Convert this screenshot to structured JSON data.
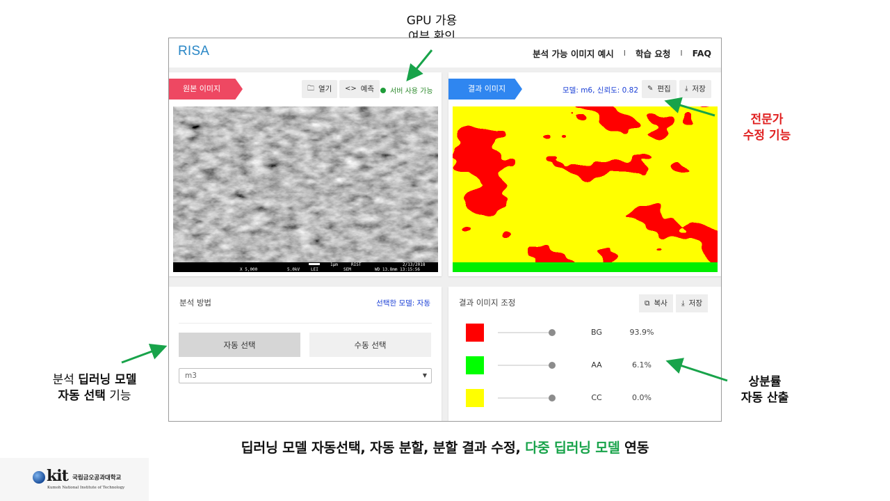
{
  "app": {
    "brand": "RISA",
    "nav": [
      "분석 가능 이미지 예시",
      "학습 요청",
      "FAQ"
    ],
    "nav_separator": "I"
  },
  "source_panel": {
    "ribbon": "원본 이미지",
    "open_label": "열기",
    "predict_label": "예측",
    "server_status": "서버 사용 가능",
    "sem_footer": {
      "scale": "1μm",
      "lab": "RIST",
      "date": "2/13/2018",
      "mag": "X 5,000",
      "kv": "5.0kV",
      "detector": "LEI",
      "mode": "SEM",
      "wd": "WD 13.8mm 13:15:56"
    }
  },
  "result_panel": {
    "ribbon": "결과 이미지",
    "model_info": "모델: m6, 신뢰도: 0.82",
    "edit_label": "편집",
    "save_label": "저장"
  },
  "method_panel": {
    "title": "분석 방법",
    "selected_model": "선택한 모델: 자동",
    "auto_label": "자동 선택",
    "manual_label": "수동 선택",
    "model_value": "m3"
  },
  "adjust_panel": {
    "title": "결과 이미지 조정",
    "copy_label": "복사",
    "save_label": "저장",
    "classes": [
      {
        "name": "BG",
        "percent": "93.9%",
        "color": "#ff0000"
      },
      {
        "name": "AA",
        "percent": "6.1%",
        "color": "#00ff00"
      },
      {
        "name": "CC",
        "percent": "0.0%",
        "color": "#ffff00"
      }
    ]
  },
  "annotations": {
    "gpu_line1": "GPU 가용",
    "gpu_line2": "여부 확인",
    "edit_line1": "전문가",
    "edit_line2": "수정 기능",
    "method_line1_pre": "분석 ",
    "method_line1_bold": "딥러닝 모델",
    "method_line2_bold": "자동 선택",
    "method_line2_post": " 기능",
    "ratio_line1": "상분률",
    "ratio_line2": "자동 산출"
  },
  "caption": {
    "main": "딥러닝 모델 자동선택, 자동 분할, 분할 결과 수정, ",
    "highlight": "다중 딥러닝 모델",
    "tail": " 연동"
  },
  "logo": {
    "mark_text": "kit",
    "kor_name": "국립금오공과대학교",
    "eng_name": "Kumoh National Institute of Technology"
  },
  "colors": {
    "accent_blue": "#2a87c6",
    "ribbon_red": "#ee4862",
    "ribbon_blue": "#2f86f0",
    "arrow_green": "#18a34a"
  }
}
